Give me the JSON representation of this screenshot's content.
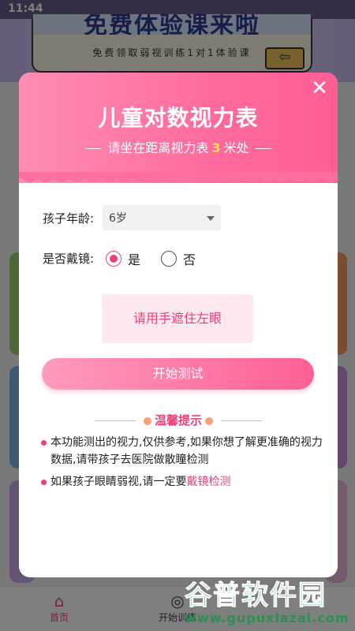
{
  "status_bar": {
    "time": "11:44"
  },
  "background": {
    "banner_title": "免费体验课来啦",
    "banner_subtitle": "免费领取弱视训练1对1体验课",
    "nav": {
      "home": "首页",
      "train": "开始训练"
    }
  },
  "watermark": {
    "cn": "谷普软件园",
    "en": "www.gupuxlazal.com"
  },
  "modal": {
    "title": "儿童对数视力表",
    "subtitle_prefix": "请坐在距离视力表",
    "distance": "3",
    "subtitle_suffix": "米处",
    "age_label": "孩子年龄:",
    "age_value": "6岁",
    "glasses_label": "是否戴镜:",
    "glasses_yes": "是",
    "glasses_no": "否",
    "glasses_selected": "yes",
    "cover_instruction": "请用手遮住左眼",
    "start_button": "开始测试",
    "tips_title": "温馨提示",
    "tip1": "本功能测出的视力,仅供参考,如果你想了解更准确的视力数据,请带孩子去医院做散瞳检测",
    "tip2_prefix": "如果孩子眼睛弱视,请一定要",
    "tip2_highlight": "戴镜检测"
  },
  "colors": {
    "accent": "#e8427a",
    "header": "#ff6b9f",
    "highlight": "#ffe04a"
  }
}
